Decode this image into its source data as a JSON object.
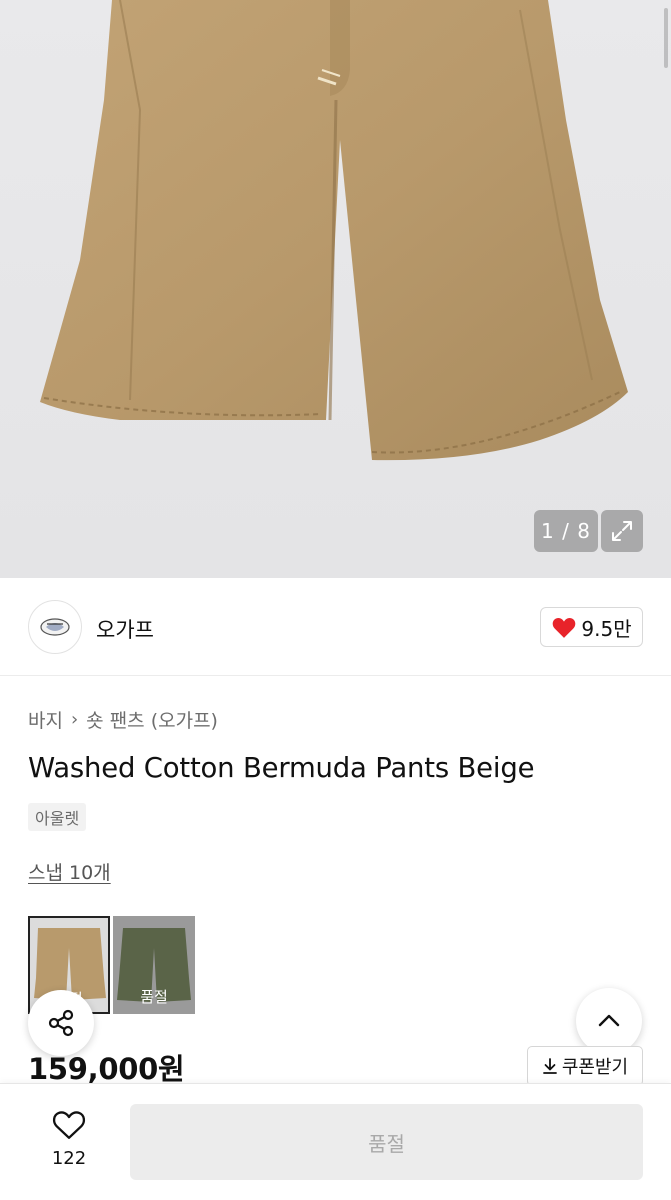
{
  "gallery": {
    "counter": "1 / 8",
    "icons": {
      "expand": "expand-icon"
    }
  },
  "brand": {
    "name": "오가프",
    "like_count": "9.5만",
    "icons": {
      "like": "heart-icon",
      "logo": "brand-logo"
    }
  },
  "product": {
    "breadcrumb": [
      "바지",
      "숏 팬츠 (오가프)"
    ],
    "title": "Washed Cotton Bermuda Pants Beige",
    "tag": "아울렛",
    "snap_link": "스냅 10개",
    "swatches": [
      {
        "color": "#b89a6c",
        "selected": true,
        "label": "품절"
      },
      {
        "color": "#5a6448",
        "selected": false,
        "label": "품절"
      }
    ],
    "price": "159,000원",
    "coupon_label": "쿠폰받기"
  },
  "floating": {
    "icons": {
      "share": "share-icon",
      "top": "chevron-up-icon"
    }
  },
  "bottom_bar": {
    "wish_count": "122",
    "buy_label": "품절",
    "icons": {
      "wish": "heart-outline-icon",
      "coupon": "download-icon"
    }
  },
  "colors": {
    "accent_red": "#e8232a",
    "product_beige": "#b89a6c",
    "disabled_bg": "#ececec",
    "disabled_text": "#a9a9a9"
  }
}
